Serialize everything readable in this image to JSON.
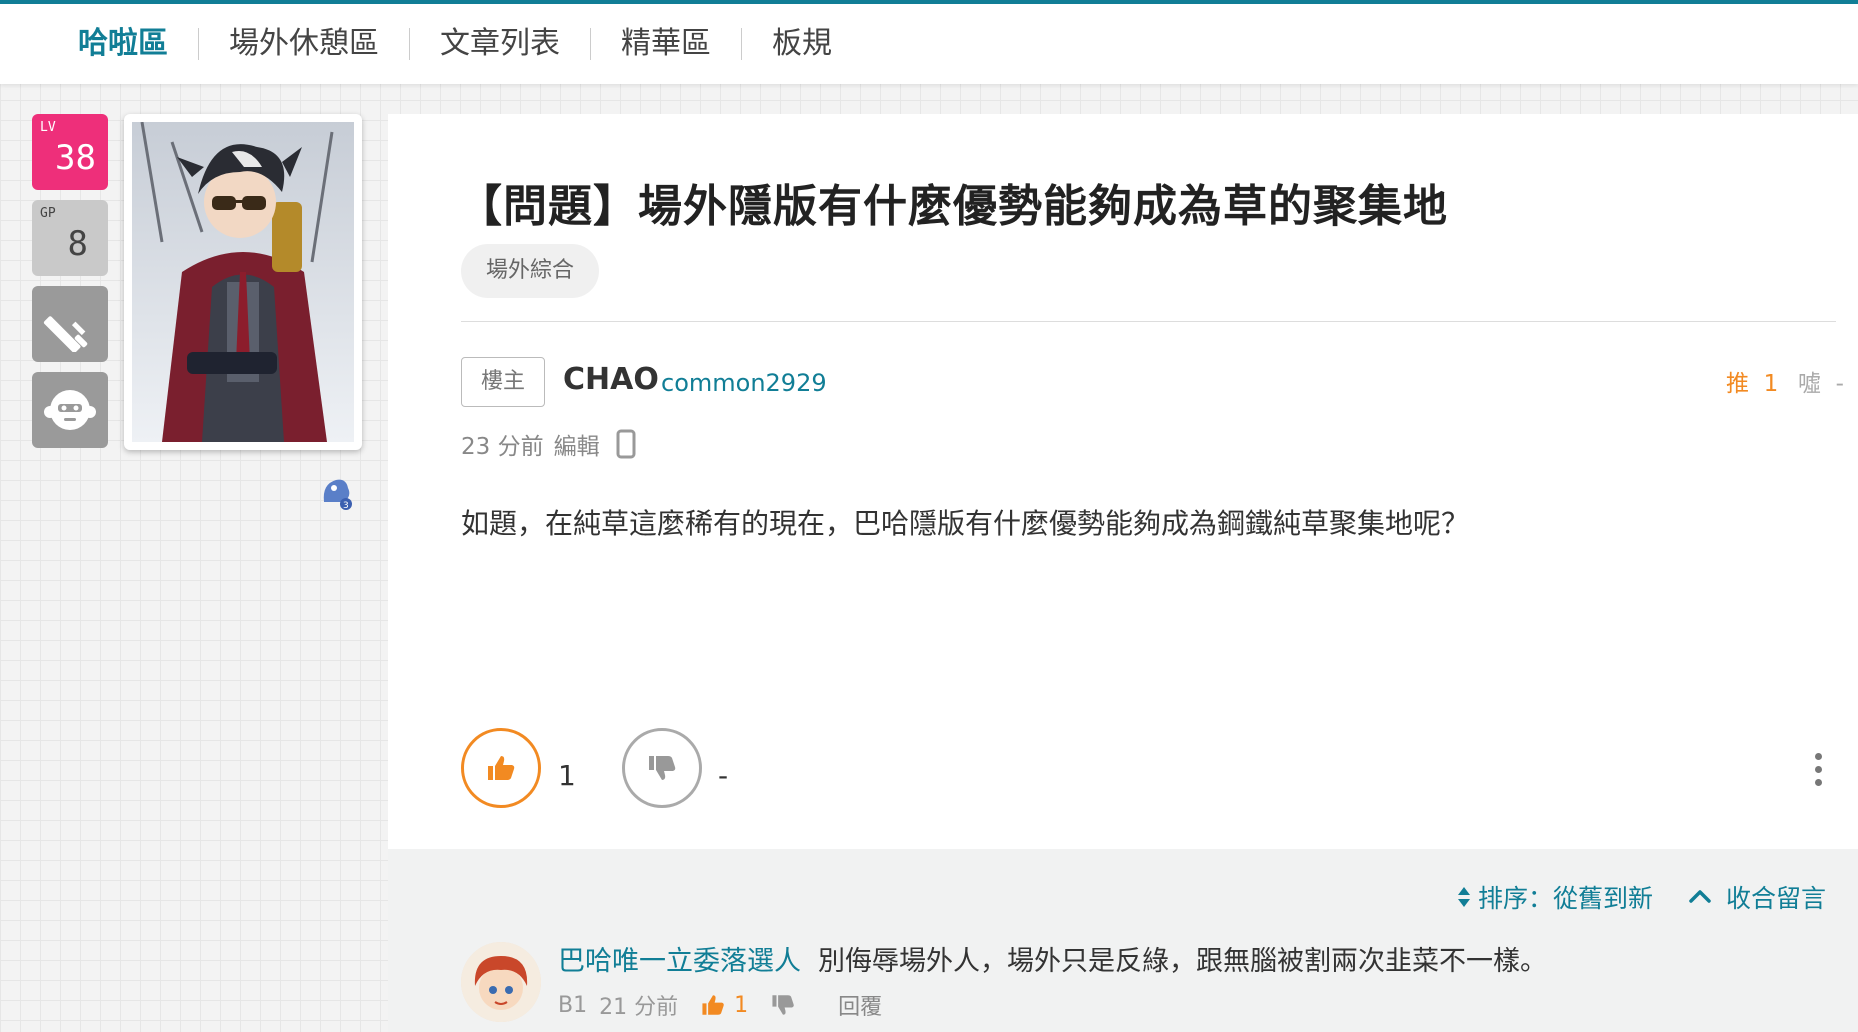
{
  "nav": {
    "items": [
      {
        "label": "哈啦區",
        "active": true
      },
      {
        "label": "場外休憩區"
      },
      {
        "label": "文章列表"
      },
      {
        "label": "精華區"
      },
      {
        "label": "板規"
      }
    ]
  },
  "user": {
    "level_tag": "LV",
    "level": "38",
    "gp_tag": "GP",
    "gp": "8",
    "badge_icons": [
      "sword-icon",
      "monkey-face-icon"
    ]
  },
  "post": {
    "title": "【問題】場外隱版有什麼優勢能夠成為草的聚集地",
    "board_tag": "場外綜合",
    "owner_tag": "樓主",
    "author_name": "CHAO",
    "author_id": "common2929",
    "push_label": "推",
    "push_count": "1",
    "boo_label": "噓",
    "boo_count": "-",
    "time": "23 分前",
    "edit_label": "編輯",
    "body": "如題，在純草這麼稀有的現在，巴哈隱版有什麼優勢能夠成為鋼鐵純草聚集地呢？",
    "like_count": "1",
    "dislike_count": "-"
  },
  "comments": {
    "sort_label": "排序：從舊到新",
    "collapse_label": "收合留言",
    "items": [
      {
        "author": "巴哈唯一立委落選人",
        "text": "別侮辱場外人，場外只是反綠，跟無腦被割兩次韭菜不一樣。",
        "floor": "B1",
        "time": "21 分前",
        "likes": "1",
        "reply_label": "回覆"
      }
    ]
  },
  "colors": {
    "accent": "#117e96",
    "like": "#f28a22",
    "level_badge": "#ee2f7a"
  }
}
